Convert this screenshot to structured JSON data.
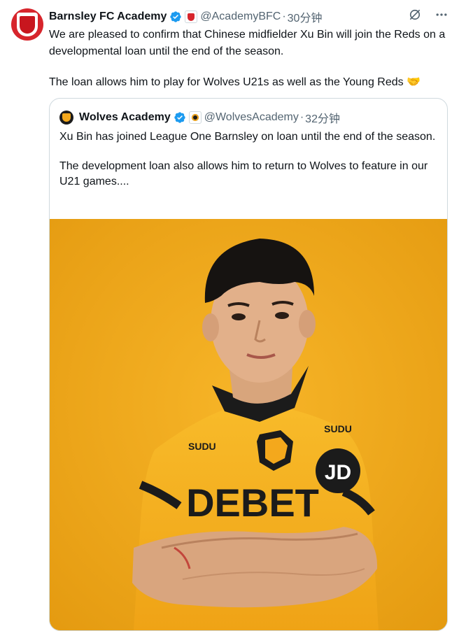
{
  "tweet": {
    "display_name": "Barnsley FC Academy",
    "handle": "@AcademyBFC",
    "separator": "·",
    "time": "30分钟",
    "paragraphs": [
      "We are pleased to confirm that Chinese midfielder Xu Bin will join the Reds on a developmental loan until the end of the season.",
      "The loan allows him to play for Wolves U21s as well as the Young Reds 🤝"
    ],
    "icons": {
      "verified": "verified-checkmark-icon",
      "grok": "grok-icon",
      "more": "more-dots-icon"
    }
  },
  "quote": {
    "display_name": "Wolves Academy",
    "handle": "@WolvesAcademy",
    "separator": "·",
    "time": "32分钟",
    "paragraphs": [
      "Xu Bin has joined League One Barnsley on loan until the end of the season.",
      "The development loan also allows him to return to Wolves to feature in our U21 games...."
    ],
    "image": {
      "background_color": "#f1a817",
      "shirt_color": "#f6b21e",
      "shirt_text_sponsor": "DEBET",
      "shirt_text_maker": "SUDU",
      "shirt_text_sleeve": "JD"
    }
  },
  "colors": {
    "verified_blue": "#1d9bf0",
    "secondary_text": "#536471",
    "barnsley_red": "#d7252c"
  }
}
